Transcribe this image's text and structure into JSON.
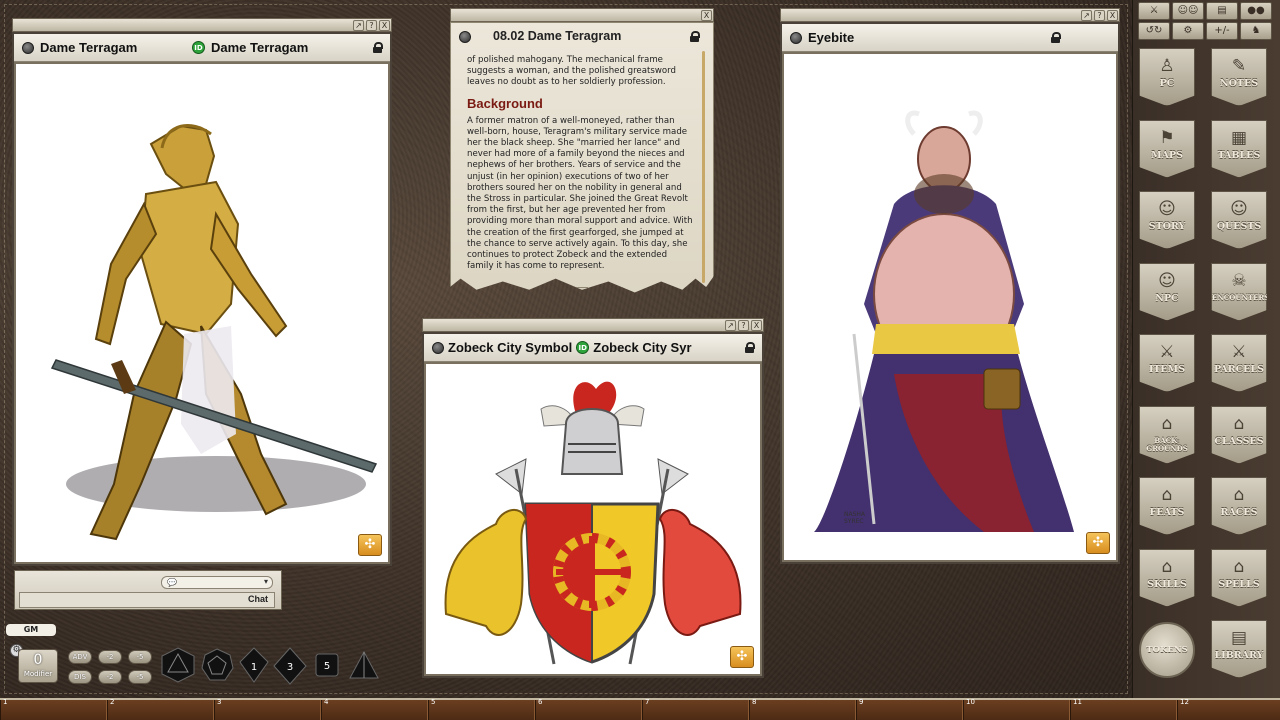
{
  "windows": {
    "dame_image": {
      "title": "Dame Terragam",
      "id_title": "Dame Terragam",
      "id_badge": "ID"
    },
    "story": {
      "title": "08.02 Dame Teragram",
      "intro": "of polished mahogany. The mechanical frame suggests a woman, and the polished greatsword leaves no doubt as to her soldierly profession.",
      "heading": "Background",
      "body": "A former matron of a well-moneyed, rather than well-born, house, Teragram's military service made her the black sheep. She \"married her lance\" and never had more of a family beyond the nieces and nephews of her brothers. Years of service and the unjust (in her opinion) executions of two of her brothers soured her on the nobility in general and the Stross in particular. She joined the Great Revolt from the first, but her age prevented her from providing more than moral support and advice. With the creation of the first gearforged, she jumped at the chance to serve actively again. To this day, she continues to protect Zobeck and the extended family it has come to represent."
    },
    "symbol_image": {
      "title": "Zobeck City Symbol",
      "id_title": "Zobeck City Syr",
      "id_badge": "ID"
    },
    "eyebite_image": {
      "title": "Eyebite",
      "signature": "NASHA\nSYREC"
    }
  },
  "window_buttons": {
    "link": "↗",
    "help": "?",
    "close": "X"
  },
  "sidebar": {
    "toolbar": [
      "⚔",
      "☺☺",
      "▤",
      "●●",
      "↺↻",
      "⚙",
      "+/-",
      "♞"
    ],
    "buttons": [
      {
        "label": "PC",
        "glyph": "♙"
      },
      {
        "label": "NOTES",
        "glyph": "✎"
      },
      {
        "label": "MAPS",
        "glyph": "⚑"
      },
      {
        "label": "TABLES",
        "glyph": "▦"
      },
      {
        "label": "STORY",
        "glyph": "☺"
      },
      {
        "label": "QUESTS",
        "glyph": "☺"
      },
      {
        "label": "NPC",
        "glyph": "☺"
      },
      {
        "label": "ENCOUNTERS",
        "glyph": "☠"
      },
      {
        "label": "ITEMS",
        "glyph": "⚔"
      },
      {
        "label": "PARCELS",
        "glyph": "⚔"
      },
      {
        "label": "BACK-GROUNDS",
        "glyph": "⌂"
      },
      {
        "label": "CLASSES",
        "glyph": "⌂"
      },
      {
        "label": "FEATS",
        "glyph": "⌂"
      },
      {
        "label": "RACES",
        "glyph": "⌂"
      },
      {
        "label": "SKILLS",
        "glyph": "⌂"
      },
      {
        "label": "SPELLS",
        "glyph": "⌂"
      }
    ],
    "tokens_label": "TOKENS",
    "library_label": "LIBRARY"
  },
  "chat": {
    "send_label": "Chat",
    "identity": "GM"
  },
  "modifier": {
    "value": "0",
    "label": "Modifier"
  },
  "modifier_buttons": {
    "adv": "ADV",
    "dis": "DIS",
    "m2a": "-2",
    "m5a": "-5",
    "p2": "-2",
    "p5": "-5"
  },
  "dice": [
    "d20",
    "d12",
    "d10",
    "d8",
    "d6",
    "d4"
  ],
  "dice_faces": [
    "",
    "",
    "1",
    "3",
    "5",
    ""
  ],
  "hotkeys": [
    "1",
    "2",
    "3",
    "4",
    "5",
    "6",
    "7",
    "8",
    "9",
    "10",
    "11",
    "12"
  ],
  "colors": {
    "accent": "#7a1a12",
    "id_badge": "#2fa33b",
    "share": "#e4a23a"
  }
}
